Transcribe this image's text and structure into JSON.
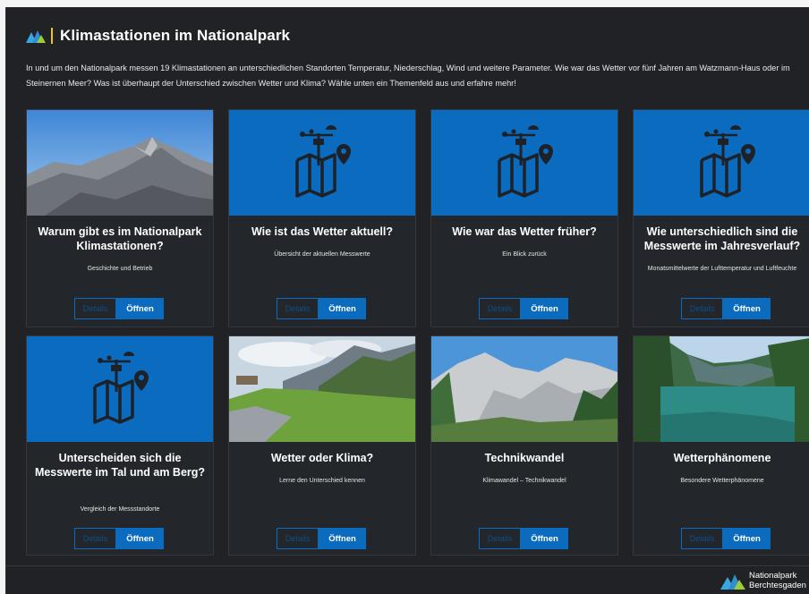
{
  "page": {
    "title": "Klimastationen im Nationalpark",
    "intro": "In und um den Nationalpark messen 19 Klimastationen an unterschiedlichen Standorten Temperatur, Niederschlag, Wind und weitere Parameter. Wie war das Wetter vor fünf Jahren am Watzmann-Haus oder im Steinernen Meer? Was ist überhaupt der Unterschied zwischen Wetter und Klima? Wähle unten ein Themenfeld aus und erfahre mehr!",
    "accent_color": "#0b6bbf",
    "logo_icon": "mountains-logo-icon"
  },
  "buttons": {
    "details": "Details",
    "open": "Öffnen"
  },
  "cards": [
    {
      "title": "Warum gibt es im Nationalpark Klimastationen?",
      "subtitle": "Geschichte und Betrieb",
      "media": "photo-rocky-peak"
    },
    {
      "title": "Wie ist das Wetter aktuell?",
      "subtitle": "Übersicht der aktuellen Messwerte",
      "media": "weather-map-icon"
    },
    {
      "title": "Wie war das Wetter früher?",
      "subtitle": "Ein Blick zurück",
      "media": "weather-map-icon"
    },
    {
      "title": "Wie unterschiedlich sind die Messwerte im Jahresverlauf?",
      "subtitle": "Monatsmittelwerte der Lufttemperatur und Luftfeuchte",
      "media": "weather-map-icon"
    },
    {
      "title": "Unterscheiden sich die Messwerte im Tal und am Berg?",
      "subtitle": "Vergleich der Messstandorte",
      "media": "weather-map-icon"
    },
    {
      "title": "Wetter oder Klima?",
      "subtitle": "Lerne den Unterschied kennen",
      "media": "photo-alpine-meadow"
    },
    {
      "title": "Technikwandel",
      "subtitle": "Klimawandel – Technikwandel",
      "media": "photo-limestone-cliffs"
    },
    {
      "title": "Wetterphänomene",
      "subtitle": "Besondere Wetterphänomene",
      "media": "photo-mountain-lake"
    }
  ],
  "footer": {
    "brand_line1": "Nationalpark",
    "brand_line2": "Berchtesgaden"
  }
}
